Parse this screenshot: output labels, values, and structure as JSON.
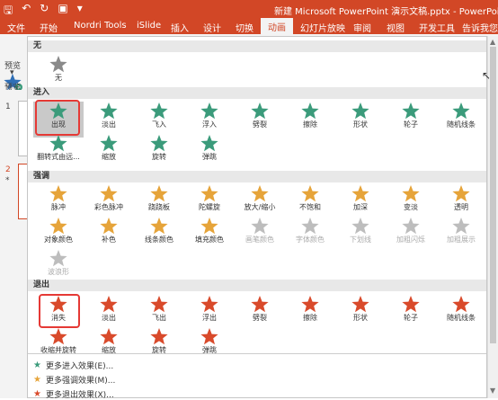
{
  "titlebar": {
    "title": "新建 Microsoft PowerPoint 演示文稿.pptx - PowerPoint",
    "icons": [
      "save-icon",
      "undo-icon",
      "redo-icon",
      "present-icon",
      "quick-access-dropdown-icon"
    ]
  },
  "tabs": [
    {
      "label": "文件"
    },
    {
      "label": "开始"
    },
    {
      "label": "Nordri Tools"
    },
    {
      "label": "iSlide"
    },
    {
      "label": "插入"
    },
    {
      "label": "设计"
    },
    {
      "label": "切换"
    },
    {
      "label": "动画"
    },
    {
      "label": "幻灯片放映"
    },
    {
      "label": "审阅"
    },
    {
      "label": "视图"
    },
    {
      "label": "开发工具"
    },
    {
      "label": "告诉我您"
    }
  ],
  "ribbon": {
    "preview_label": "预览",
    "preview_group": "预览",
    "effects_label": "效"
  },
  "slides": {
    "n1": "1",
    "n2": "2",
    "star": "*"
  },
  "sections": {
    "none": "无",
    "entrance": "进入",
    "emphasis": "强调",
    "exit": "退出"
  },
  "none_items": [
    {
      "label": "无"
    }
  ],
  "entrance_items": [
    {
      "label": "出现"
    },
    {
      "label": "淡出"
    },
    {
      "label": "飞入"
    },
    {
      "label": "浮入"
    },
    {
      "label": "劈裂"
    },
    {
      "label": "擦除"
    },
    {
      "label": "形状"
    },
    {
      "label": "轮子"
    },
    {
      "label": "随机线条"
    },
    {
      "label": "翻转式由远..."
    },
    {
      "label": "缩放"
    },
    {
      "label": "旋转"
    },
    {
      "label": "弹跳"
    }
  ],
  "emphasis_items": [
    {
      "label": "脉冲"
    },
    {
      "label": "彩色脉冲"
    },
    {
      "label": "跷跷板"
    },
    {
      "label": "陀螺旋"
    },
    {
      "label": "放大/缩小"
    },
    {
      "label": "不饱和"
    },
    {
      "label": "加深"
    },
    {
      "label": "变淡"
    },
    {
      "label": "透明"
    },
    {
      "label": "对象颜色"
    },
    {
      "label": "补色"
    },
    {
      "label": "线条颜色"
    },
    {
      "label": "填充颜色"
    },
    {
      "label": "画笔颜色"
    },
    {
      "label": "字体颜色"
    },
    {
      "label": "下划线"
    },
    {
      "label": "加粗闪烁"
    },
    {
      "label": "加粗展示"
    },
    {
      "label": "波浪形"
    }
  ],
  "exit_items": [
    {
      "label": "消失"
    },
    {
      "label": "淡出"
    },
    {
      "label": "飞出"
    },
    {
      "label": "浮出"
    },
    {
      "label": "劈裂"
    },
    {
      "label": "擦除"
    },
    {
      "label": "形状"
    },
    {
      "label": "轮子"
    },
    {
      "label": "随机线条"
    },
    {
      "label": "收缩并旋转"
    },
    {
      "label": "缩放"
    },
    {
      "label": "旋转"
    },
    {
      "label": "弹跳"
    }
  ],
  "more": {
    "entrance": "更多进入效果(E)...",
    "emphasis": "更多强调效果(M)...",
    "exit": "更多退出效果(X)..."
  },
  "colors": {
    "titlebar": "#d24726",
    "none_star": "#8a8a8a",
    "entrance_star": "#3b9b7b",
    "emphasis_star": "#e6a43a",
    "emphasis_disabled": "#bdbdbd",
    "exit_star": "#d94a2b",
    "highlight": "#e53935"
  }
}
